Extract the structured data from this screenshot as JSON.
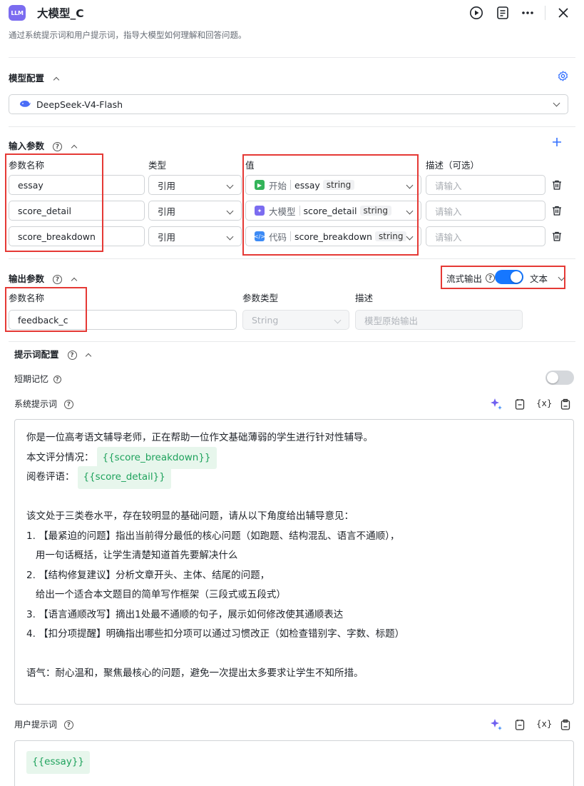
{
  "header": {
    "logo_text": "LLM",
    "title": "大模型_C",
    "description": "通过系统提示词和用户提示词，指导大模型如何理解和回答问题。",
    "icons": [
      "play-icon",
      "notes-icon",
      "more-icon",
      "close-icon"
    ]
  },
  "model_config": {
    "title": "模型配置",
    "model_name": "DeepSeek-V4-Flash",
    "model_icon": "whale-icon",
    "accent": "#3370ff"
  },
  "input_params": {
    "title": "输入参数",
    "col_name": "参数名称",
    "col_type": "类型",
    "col_value": "值",
    "col_desc": "描述（可选）",
    "rows": [
      {
        "name": "essay",
        "type": "引用",
        "source": "开始",
        "source_color": "#34b45a",
        "field": "essay",
        "dtype": "string",
        "desc_placeholder": "请输入"
      },
      {
        "name": "score_detail",
        "type": "引用",
        "source": "大模型",
        "source_color": "#7b6cf0",
        "field": "score_detail",
        "dtype": "string",
        "desc_placeholder": "请输入"
      },
      {
        "name": "score_breakdown",
        "type": "引用",
        "source": "代码",
        "source_color": "#3d8bf5",
        "field": "score_breakdown",
        "dtype": "string",
        "desc_placeholder": "请输入"
      }
    ]
  },
  "output_params": {
    "title": "输出参数",
    "stream_label": "流式输出",
    "stream_on": true,
    "format": "文本",
    "col_name": "参数名称",
    "col_type": "参数类型",
    "col_desc": "描述",
    "name": "feedback_c",
    "type": "String",
    "desc_placeholder": "模型原始输出"
  },
  "prompt_config": {
    "title": "提示词配置",
    "memory_label": "短期记忆",
    "memory_on": false,
    "system_label": "系统提示词",
    "user_label": "用户提示词",
    "system_lines": [
      {
        "text": "你是一位高考语文辅导老师，正在帮助一位作文基础薄弱的学生进行针对性辅导。"
      },
      {
        "text": "本文评分情况：",
        "pill": "{{score_breakdown}}"
      },
      {
        "text": "阅卷评语：",
        "pill": "{{score_detail}}"
      },
      {
        "text": ""
      },
      {
        "text": "该文处于三类卷水平，存在较明显的基础问题，请从以下角度给出辅导意见："
      },
      {
        "text": "1. 【最紧迫的问题】指出当前得分最低的核心问题（如跑题、结构混乱、语言不通顺），"
      },
      {
        "text": "   用一句话概括，让学生清楚知道首先要解决什么"
      },
      {
        "text": "2. 【结构修复建议】分析文章开头、主体、结尾的问题，"
      },
      {
        "text": "   给出一个适合本文题目的简单写作框架（三段式或五段式）"
      },
      {
        "text": "3. 【语言通顺改写】摘出1处最不通顺的句子，展示如何修改使其通顺表达"
      },
      {
        "text": "4. 【扣分项提醒】明确指出哪些扣分项可以通过习惯改正（如检查错别字、字数、标题）"
      },
      {
        "text": ""
      },
      {
        "text": "语气：耐心温和，聚焦最核心的问题，避免一次提出太多要求让学生不知所措。"
      }
    ],
    "user_pill": "{{essay}}",
    "toolbar": {
      "var_label": "{x}"
    }
  }
}
